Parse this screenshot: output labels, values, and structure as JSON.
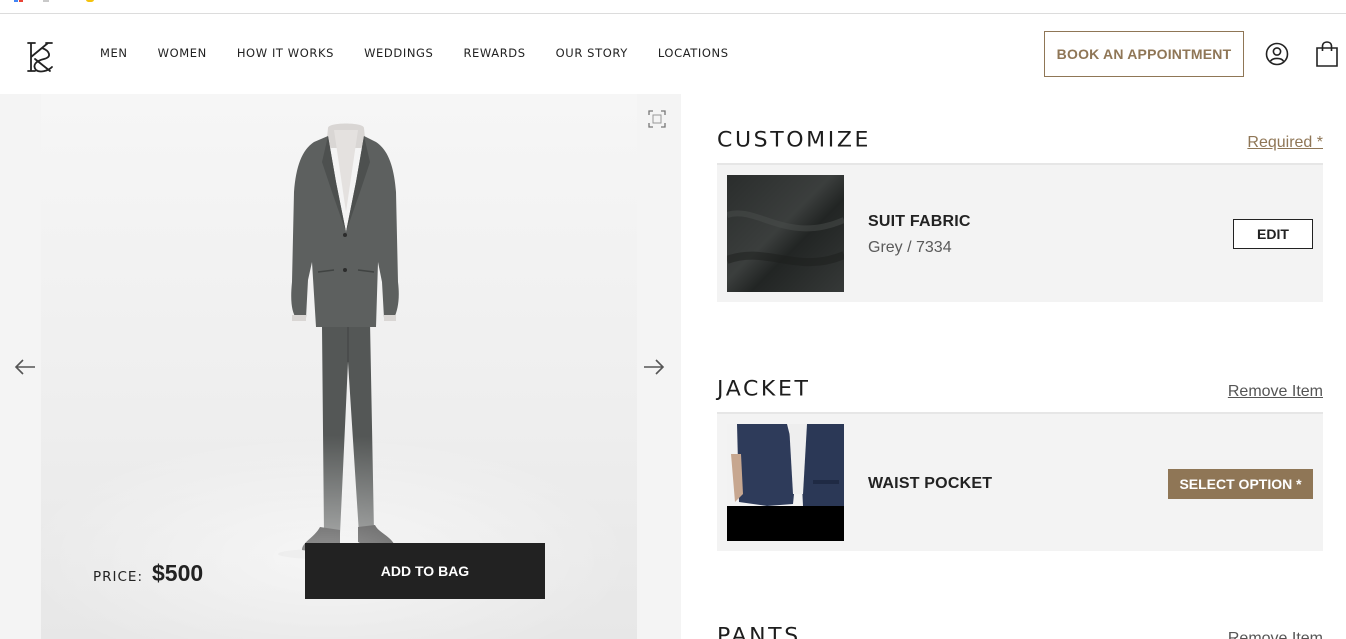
{
  "colors": {
    "accent": "#8f7656",
    "dark_button": "#222222",
    "card_background": "#f3f3f3",
    "gallery_background": "#f4f4f4"
  },
  "header": {
    "logo_icon": "brand-monogram-icon",
    "nav": [
      "MEN",
      "WOMEN",
      "HOW IT WORKS",
      "WEDDINGS",
      "REWARDS",
      "OUR STORY",
      "LOCATIONS"
    ],
    "book_button": "BOOK AN APPOINTMENT",
    "account_icon": "account-icon",
    "bag_icon": "shopping-bag-icon"
  },
  "gallery": {
    "prev_icon": "arrow-left-icon",
    "next_icon": "arrow-right-icon",
    "expand_icon": "expand-icon",
    "price_label": "PRICE:",
    "price_value": "$500",
    "add_to_bag": "ADD TO BAG"
  },
  "sections": [
    {
      "title": "CUSTOMIZE",
      "link": "Required *",
      "item": {
        "name": "SUIT FABRIC",
        "detail": "Grey / 7334",
        "action": "EDIT"
      }
    },
    {
      "title": "JACKET",
      "link": "Remove Item",
      "item": {
        "name": "WAIST POCKET",
        "detail": "",
        "action": "SELECT OPTION *"
      }
    },
    {
      "title": "PANTS",
      "link": "Remove Item"
    }
  ]
}
